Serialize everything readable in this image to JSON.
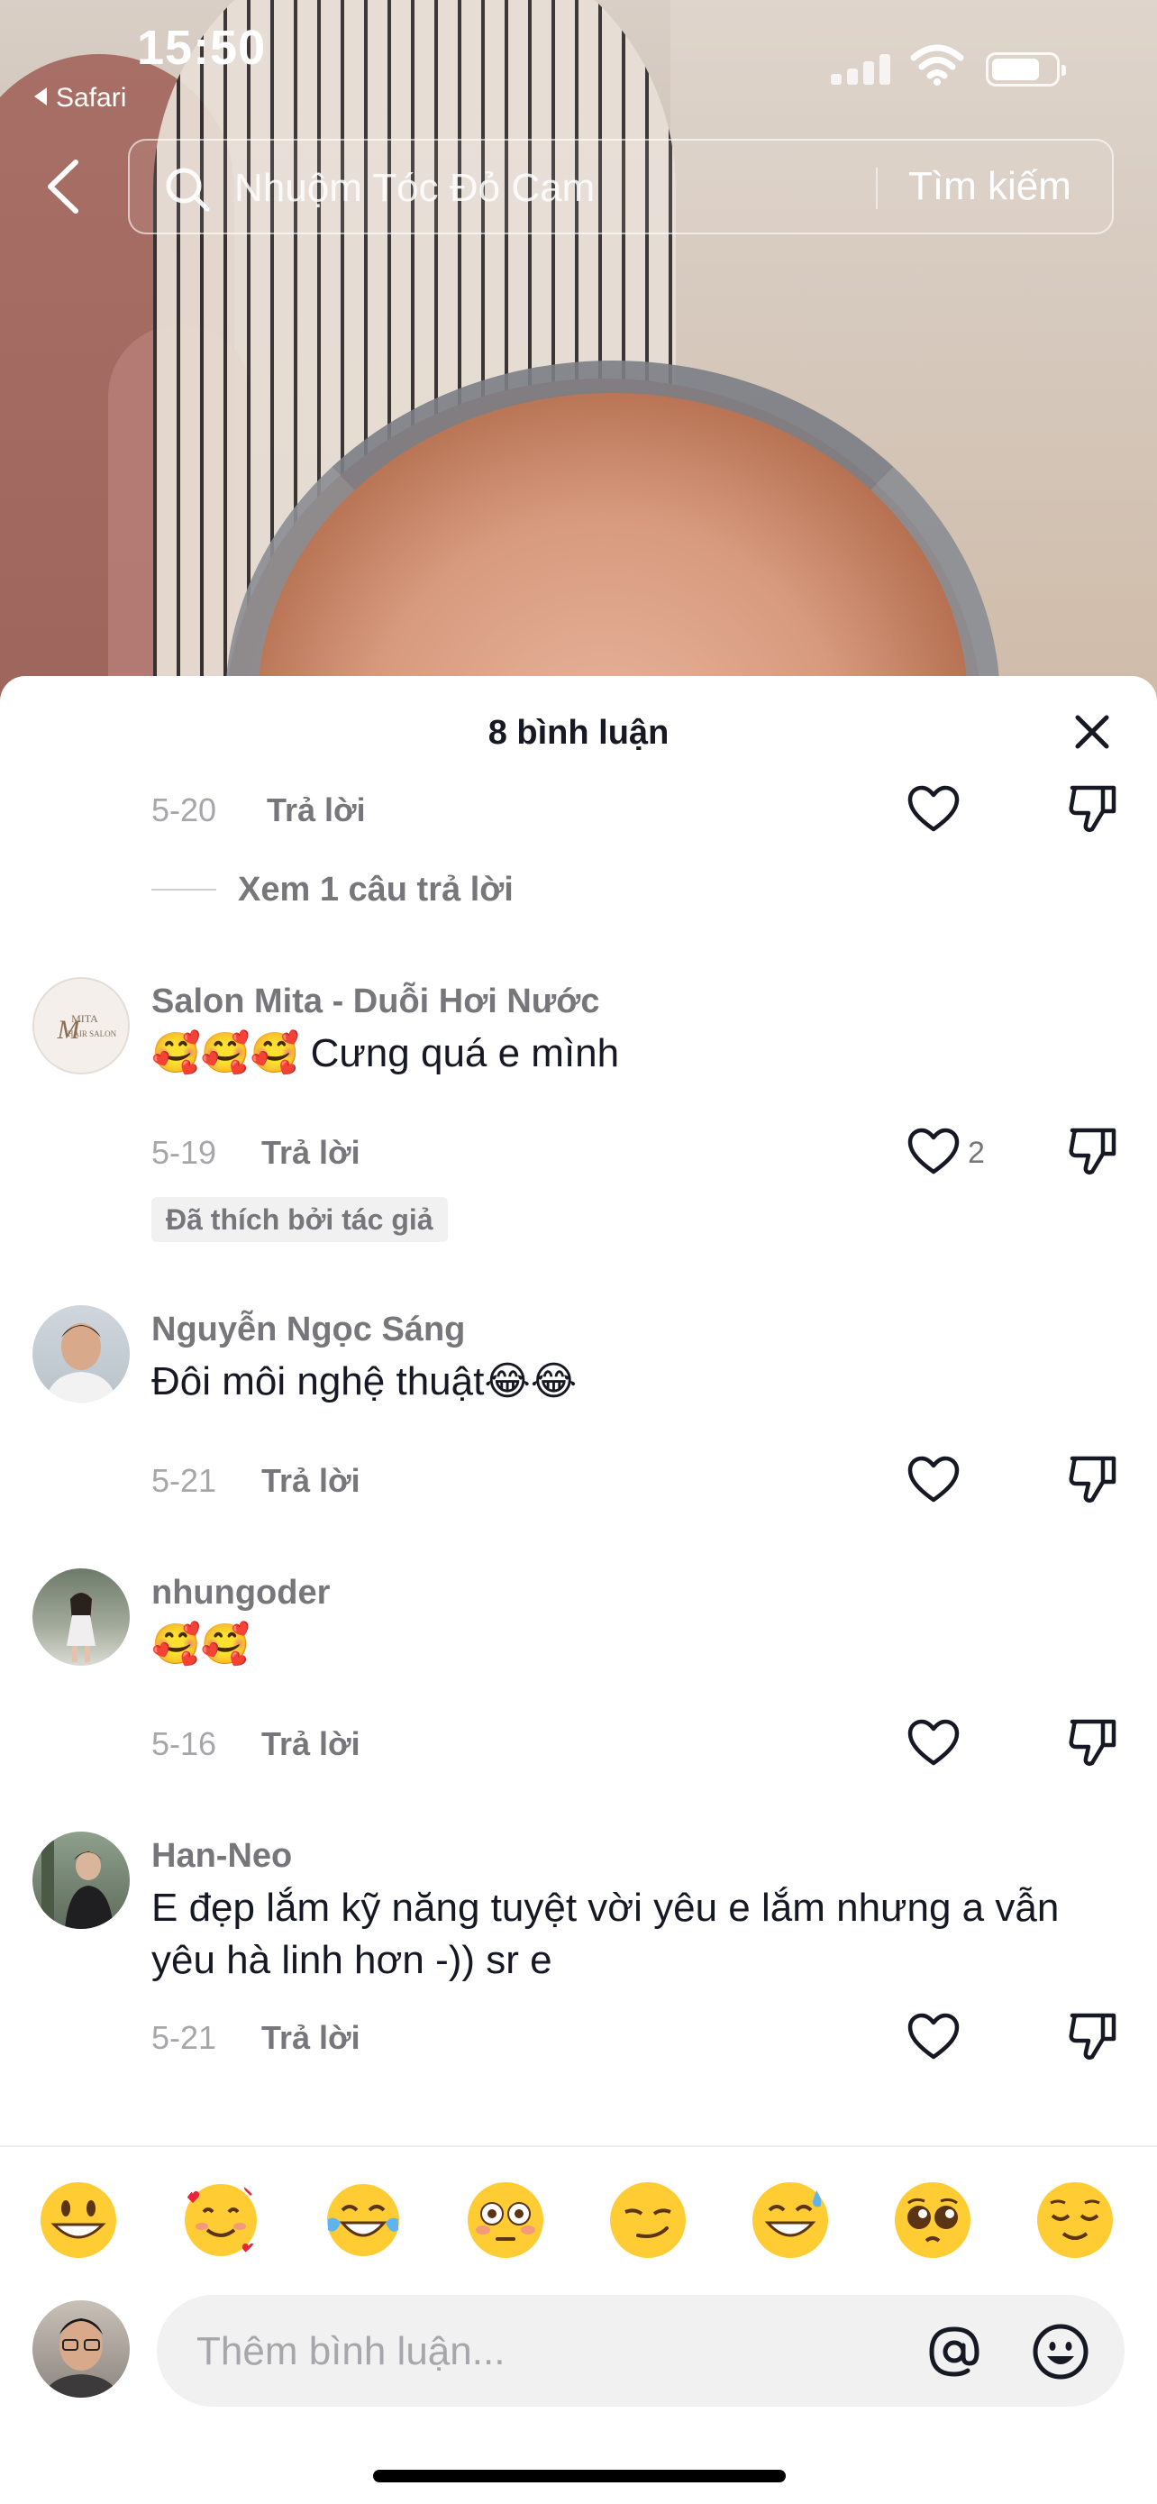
{
  "status_bar": {
    "time": "15:50",
    "back_app": "Safari"
  },
  "search": {
    "query": "Nhuộm Tóc Đỏ Cam",
    "button": "Tìm kiếm"
  },
  "comments_sheet": {
    "title": "8 bình luận",
    "reply_label": "Trả lời",
    "top_item": {
      "date": "5-20",
      "view_replies": "Xem 1 câu trả lời"
    },
    "comments": [
      {
        "username": "Salon  Mita - Duỗi Hơi Nước",
        "text": "🥰🥰🥰 Cưng quá e mình",
        "date": "5-19",
        "likes": "2",
        "author_badge": "Đã thích bởi tác giả",
        "avatar_text": "MITA HAIR SALON"
      },
      {
        "username": "Nguyễn Ngọc Sáng",
        "text": "Đôi môi nghệ thuật😂😂",
        "date": "5-21",
        "likes": "",
        "author_badge": ""
      },
      {
        "username": "nhungoder",
        "text": "🥰🥰",
        "date": "5-16",
        "likes": "",
        "author_badge": ""
      },
      {
        "username": "Han-Neo",
        "text": "E đẹp lắm kỹ năng tuyệt vời yêu e lắm nhưng a vẫn yêu hà linh hơn -)) sr e",
        "date": "5-21",
        "likes": "",
        "author_badge": ""
      }
    ]
  },
  "quick_emojis": [
    "grinning-face",
    "smiling-face-with-hearts",
    "face-with-tears-of-joy",
    "flushed-face",
    "smirking-face",
    "grinning-face-with-sweat",
    "pleading-face",
    "relieved-face"
  ],
  "composer": {
    "placeholder": "Thêm bình luận..."
  },
  "colors": {
    "text_primary": "#161823",
    "text_secondary": "#77777b",
    "text_tertiary": "#a7a7ab",
    "input_bg": "#f1f1f2",
    "emoji_yellow": "#ffcc33"
  }
}
